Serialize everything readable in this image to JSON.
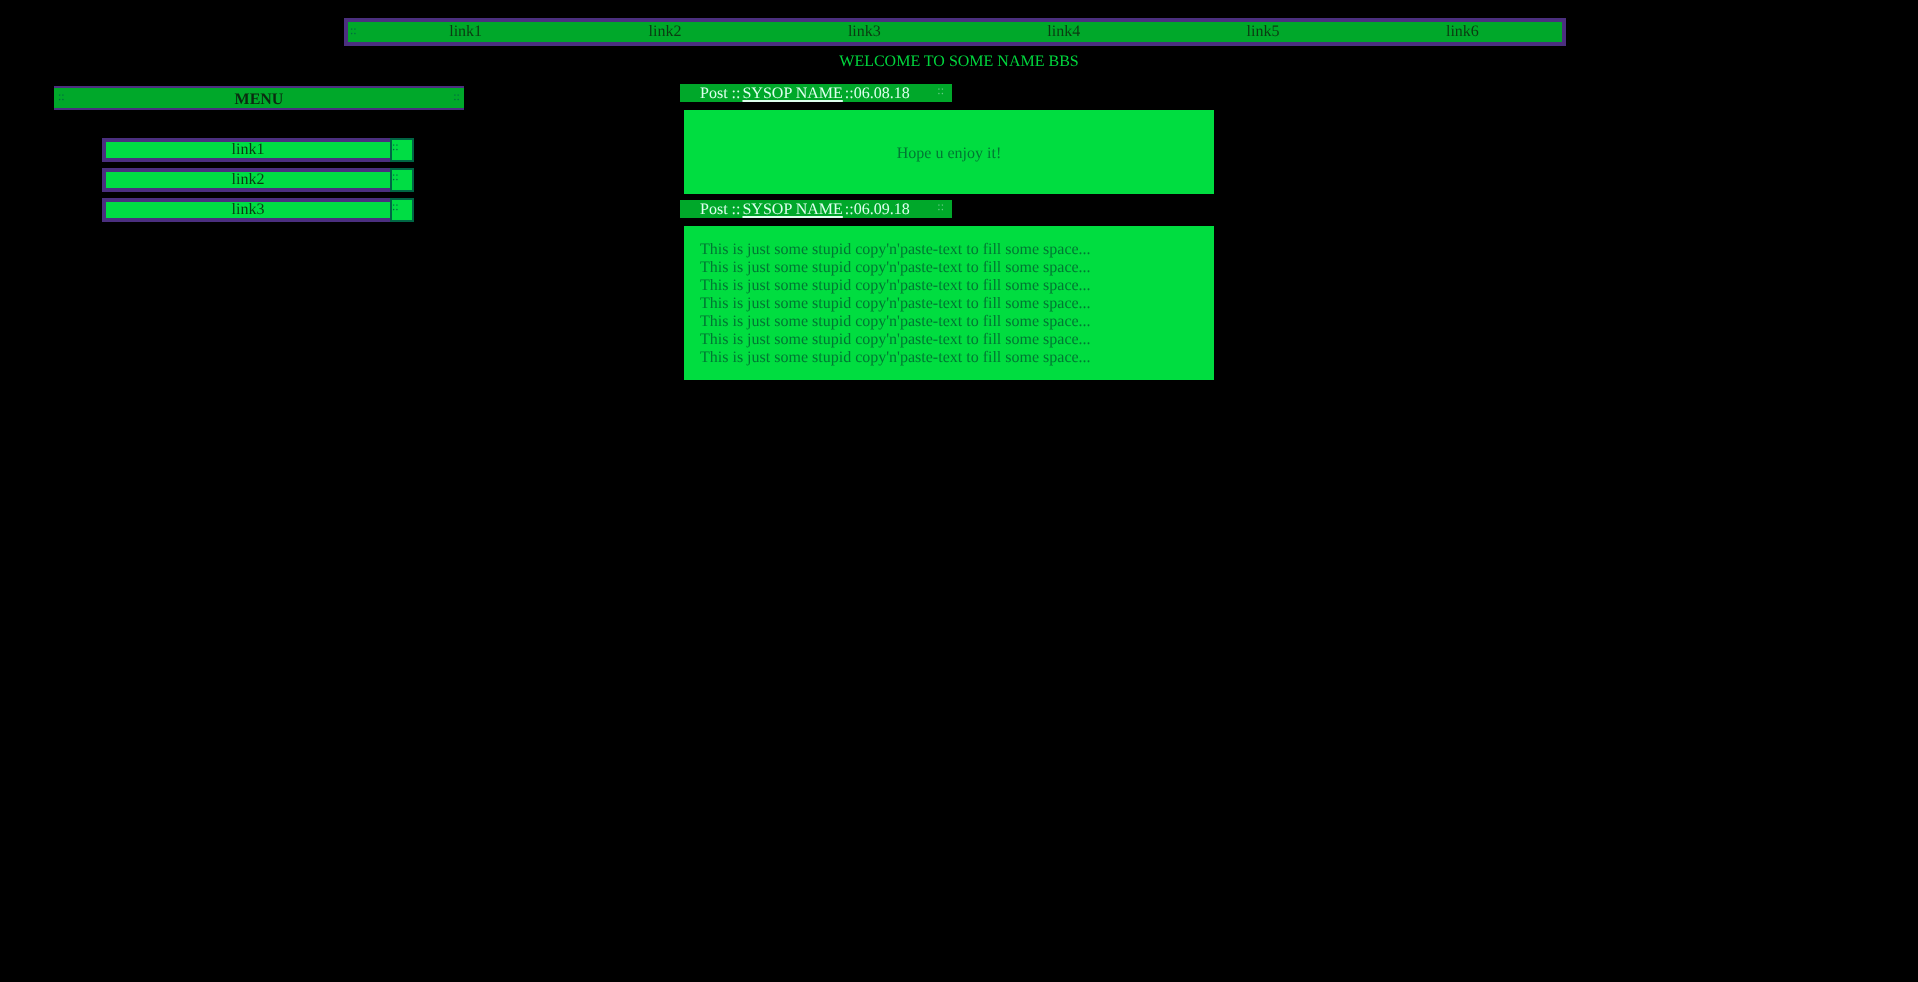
{
  "top_nav": {
    "marker": "::",
    "links": [
      {
        "label": "link1"
      },
      {
        "label": "link2"
      },
      {
        "label": "link3"
      },
      {
        "label": "link4"
      },
      {
        "label": "link5"
      },
      {
        "label": "link6"
      }
    ]
  },
  "welcome": "WELCOME TO SOME NAME BBS",
  "menu": {
    "marker_left": "::",
    "title": "MENU",
    "marker_right": "::",
    "links": [
      {
        "label": "link1",
        "marker": "::"
      },
      {
        "label": "link2",
        "marker": "::"
      },
      {
        "label": "link3",
        "marker": "::"
      }
    ]
  },
  "posts": [
    {
      "prefix": "Post ::",
      "author": "SYSOP NAME",
      "date": "::06.08.18",
      "marker": "::",
      "kind": "centered",
      "lines": [
        "Hope u enjoy it!"
      ]
    },
    {
      "prefix": "Post ::",
      "author": "SYSOP NAME",
      "date": "::06.09.18",
      "marker": "::",
      "kind": "left",
      "lines": [
        "This is just some stupid copy'n'paste-text to fill some space...",
        "This is just some stupid copy'n'paste-text to fill some space...",
        "This is just some stupid copy'n'paste-text to fill some space...",
        "This is just some stupid copy'n'paste-text to fill some space...",
        "This is just some stupid copy'n'paste-text to fill some space...",
        "This is just some stupid copy'n'paste-text to fill some space...",
        "This is just some stupid copy'n'paste-text to fill some space..."
      ]
    }
  ]
}
